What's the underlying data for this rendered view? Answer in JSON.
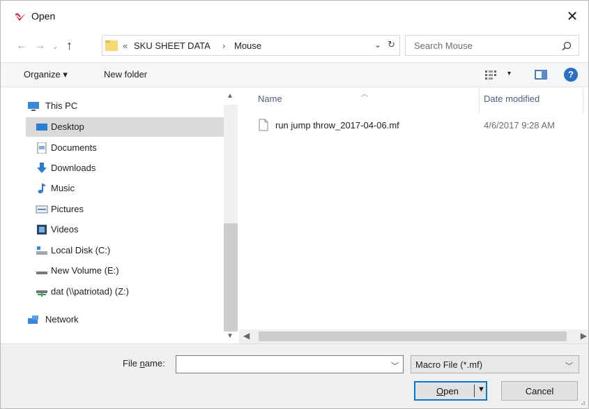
{
  "window": {
    "title": "Open",
    "close_symbol": "✕"
  },
  "nav": {
    "back": "←",
    "forward": "→",
    "recent": "⌄",
    "up": "↑",
    "address": {
      "more": "«",
      "segments": [
        "SKU SHEET DATA",
        "Mouse"
      ],
      "separator": "›",
      "dropdown": "⌄",
      "refresh": "↻"
    },
    "search": {
      "placeholder": "Search Mouse"
    }
  },
  "toolbar": {
    "organize": "Organize ▾",
    "new_folder": "New folder",
    "views_dd": "▾",
    "help": "?"
  },
  "navpane": {
    "items": [
      {
        "label": "This PC",
        "icon": "computer-icon",
        "level": 0
      },
      {
        "label": "Desktop",
        "icon": "desktop-icon",
        "level": 1,
        "selected": true
      },
      {
        "label": "Documents",
        "icon": "documents-icon",
        "level": 1
      },
      {
        "label": "Downloads",
        "icon": "downloads-icon",
        "level": 1
      },
      {
        "label": "Music",
        "icon": "music-icon",
        "level": 1
      },
      {
        "label": "Pictures",
        "icon": "pictures-icon",
        "level": 1
      },
      {
        "label": "Videos",
        "icon": "videos-icon",
        "level": 1
      },
      {
        "label": "Local Disk (C:)",
        "icon": "disk-icon",
        "level": 1
      },
      {
        "label": "New Volume (E:)",
        "icon": "drive-icon",
        "level": 1
      },
      {
        "label": "dat (\\\\patriotad) (Z:)",
        "icon": "network-drive-icon",
        "level": 1
      },
      {
        "label": "Network",
        "icon": "network-icon",
        "level": 0
      }
    ]
  },
  "filelist": {
    "columns": {
      "name": "Name",
      "date": "Date modified"
    },
    "files": [
      {
        "name": "run jump throw_2017-04-06.mf",
        "date": "4/6/2017 9:28 AM"
      }
    ]
  },
  "footer": {
    "filename_label": "File name:",
    "filename_label_accel": "n",
    "filename_value": "",
    "filter": "Macro File (*.mf)",
    "open": "Open",
    "cancel": "Cancel"
  },
  "colors": {
    "accent": "#0078d7",
    "selection": "#d9d9d9",
    "footer_bg": "#f0f0f0"
  }
}
